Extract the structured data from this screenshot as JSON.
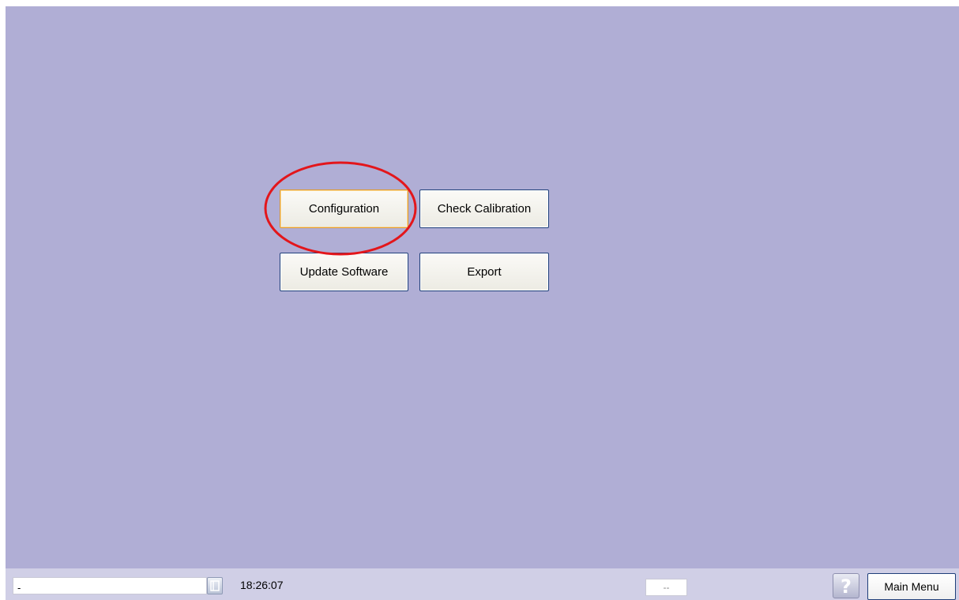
{
  "main": {
    "buttons": {
      "configuration": "Configuration",
      "check_calibration": "Check Calibration",
      "update_software": "Update Software",
      "export": "Export"
    },
    "annotation": {
      "type": "ellipse",
      "color": "#e3161b",
      "target": "configuration"
    }
  },
  "status_bar": {
    "field_value": "-",
    "restore_icon": "restore-window-icon",
    "time": "18:26:07",
    "center_value": "--",
    "help_icon": "question-mark-icon",
    "main_menu_label": "Main Menu"
  },
  "colors": {
    "background": "#b0aed5",
    "status_bar": "#d0cfe6",
    "button_border": "#1f3f7a",
    "focus_border": "#e39a2c"
  }
}
